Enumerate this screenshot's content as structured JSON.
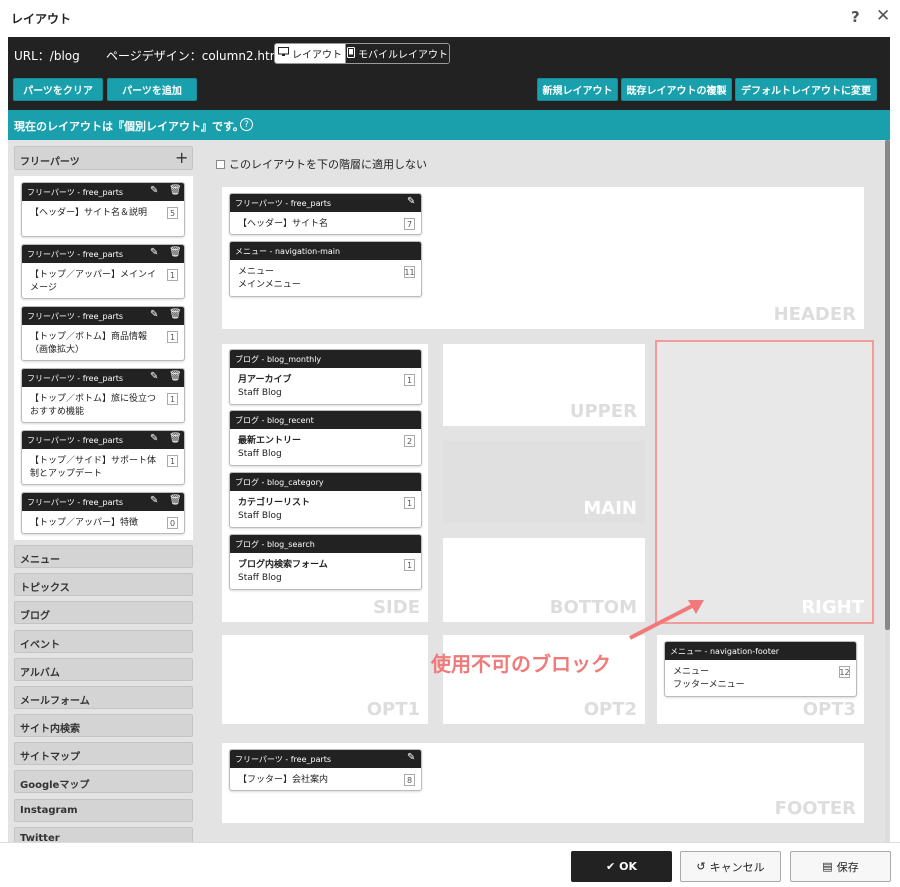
{
  "dialog": {
    "title": "レイアウト",
    "help": "?",
    "close": "✕"
  },
  "urlbar": {
    "url": "URL：/blog",
    "design": "ページデザイン：column2.htm",
    "tab_layout": "レイアウト",
    "tab_mobile": "モバイルレイアウト"
  },
  "toolbar": {
    "clear": "パーツをクリア",
    "add": "パーツを追加",
    "new": "新規レイアウト",
    "copy": "既存レイアウトの複製",
    "default": "デフォルトレイアウトに変更"
  },
  "info": {
    "text": "現在のレイアウトは『個別レイアウト』です。",
    "q": "?"
  },
  "sidebar": {
    "free_label": "フリーパーツ",
    "add_icon": "+",
    "parts": [
      {
        "head": "フリーパーツ - free_parts",
        "name": "【ヘッダー】サイト名＆説明",
        "count": "5"
      },
      {
        "head": "フリーパーツ - free_parts",
        "name": "【トップ／アッパー】メインイメージ",
        "count": "1"
      },
      {
        "head": "フリーパーツ - free_parts",
        "name": "【トップ／ボトム】商品情報（画像拡大）",
        "count": "1"
      },
      {
        "head": "フリーパーツ - free_parts",
        "name": "【トップ／ボトム】旅に役立つおすすめ機能",
        "count": "1"
      },
      {
        "head": "フリーパーツ - free_parts",
        "name": "【トップ／サイド】サポート体制とアップデート",
        "count": "1"
      },
      {
        "head": "フリーパーツ - free_parts",
        "name": "【トップ／アッパー】特徴",
        "count": "0"
      }
    ],
    "categories": [
      "メニュー",
      "トピックス",
      "ブログ",
      "イベント",
      "アルバム",
      "メールフォーム",
      "サイト内検索",
      "サイトマップ",
      "Googleマップ",
      "Instagram",
      "Twitter"
    ]
  },
  "main": {
    "checkbox_label": "このレイアウトを下の階層に適用しない",
    "regions": {
      "header": "HEADER",
      "upper": "UPPER",
      "main": "MAIN",
      "side": "SIDE",
      "bottom": "BOTTOM",
      "right": "RIGHT",
      "opt1": "OPT1",
      "opt2": "OPT2",
      "opt3": "OPT3",
      "footer": "FOOTER"
    },
    "header_parts": [
      {
        "head": "フリーパーツ - free_parts",
        "name": "【ヘッダー】サイト名",
        "sub": "",
        "count": "7"
      },
      {
        "head": "メニュー - navigation-main",
        "name": "メニュー",
        "sub": "メインメニュー",
        "count": "11"
      }
    ],
    "side_parts": [
      {
        "head": "ブログ - blog_monthly",
        "name": "月アーカイブ",
        "sub": "Staff Blog",
        "count": "1"
      },
      {
        "head": "ブログ - blog_recent",
        "name": "最新エントリー",
        "sub": "Staff Blog",
        "count": "2"
      },
      {
        "head": "ブログ - blog_category",
        "name": "カテゴリーリスト",
        "sub": "Staff Blog",
        "count": "1"
      },
      {
        "head": "ブログ - blog_search",
        "name": "ブログ内検索フォーム",
        "sub": "Staff Blog",
        "count": "1"
      }
    ],
    "opt3_part": {
      "head": "メニュー - navigation-footer",
      "name": "メニュー",
      "sub": "フッターメニュー",
      "count": "12"
    },
    "footer_part": {
      "head": "フリーパーツ - free_parts",
      "name": "【フッター】会社案内",
      "sub": "",
      "count": "8"
    },
    "annotation": "使用不可のブロック"
  },
  "footer": {
    "ok": "OK",
    "cancel": "キャンセル",
    "save": "保存"
  },
  "colors": {
    "accent": "#1aa0ad",
    "dark": "#222222",
    "annotation": "#f07a7a"
  }
}
